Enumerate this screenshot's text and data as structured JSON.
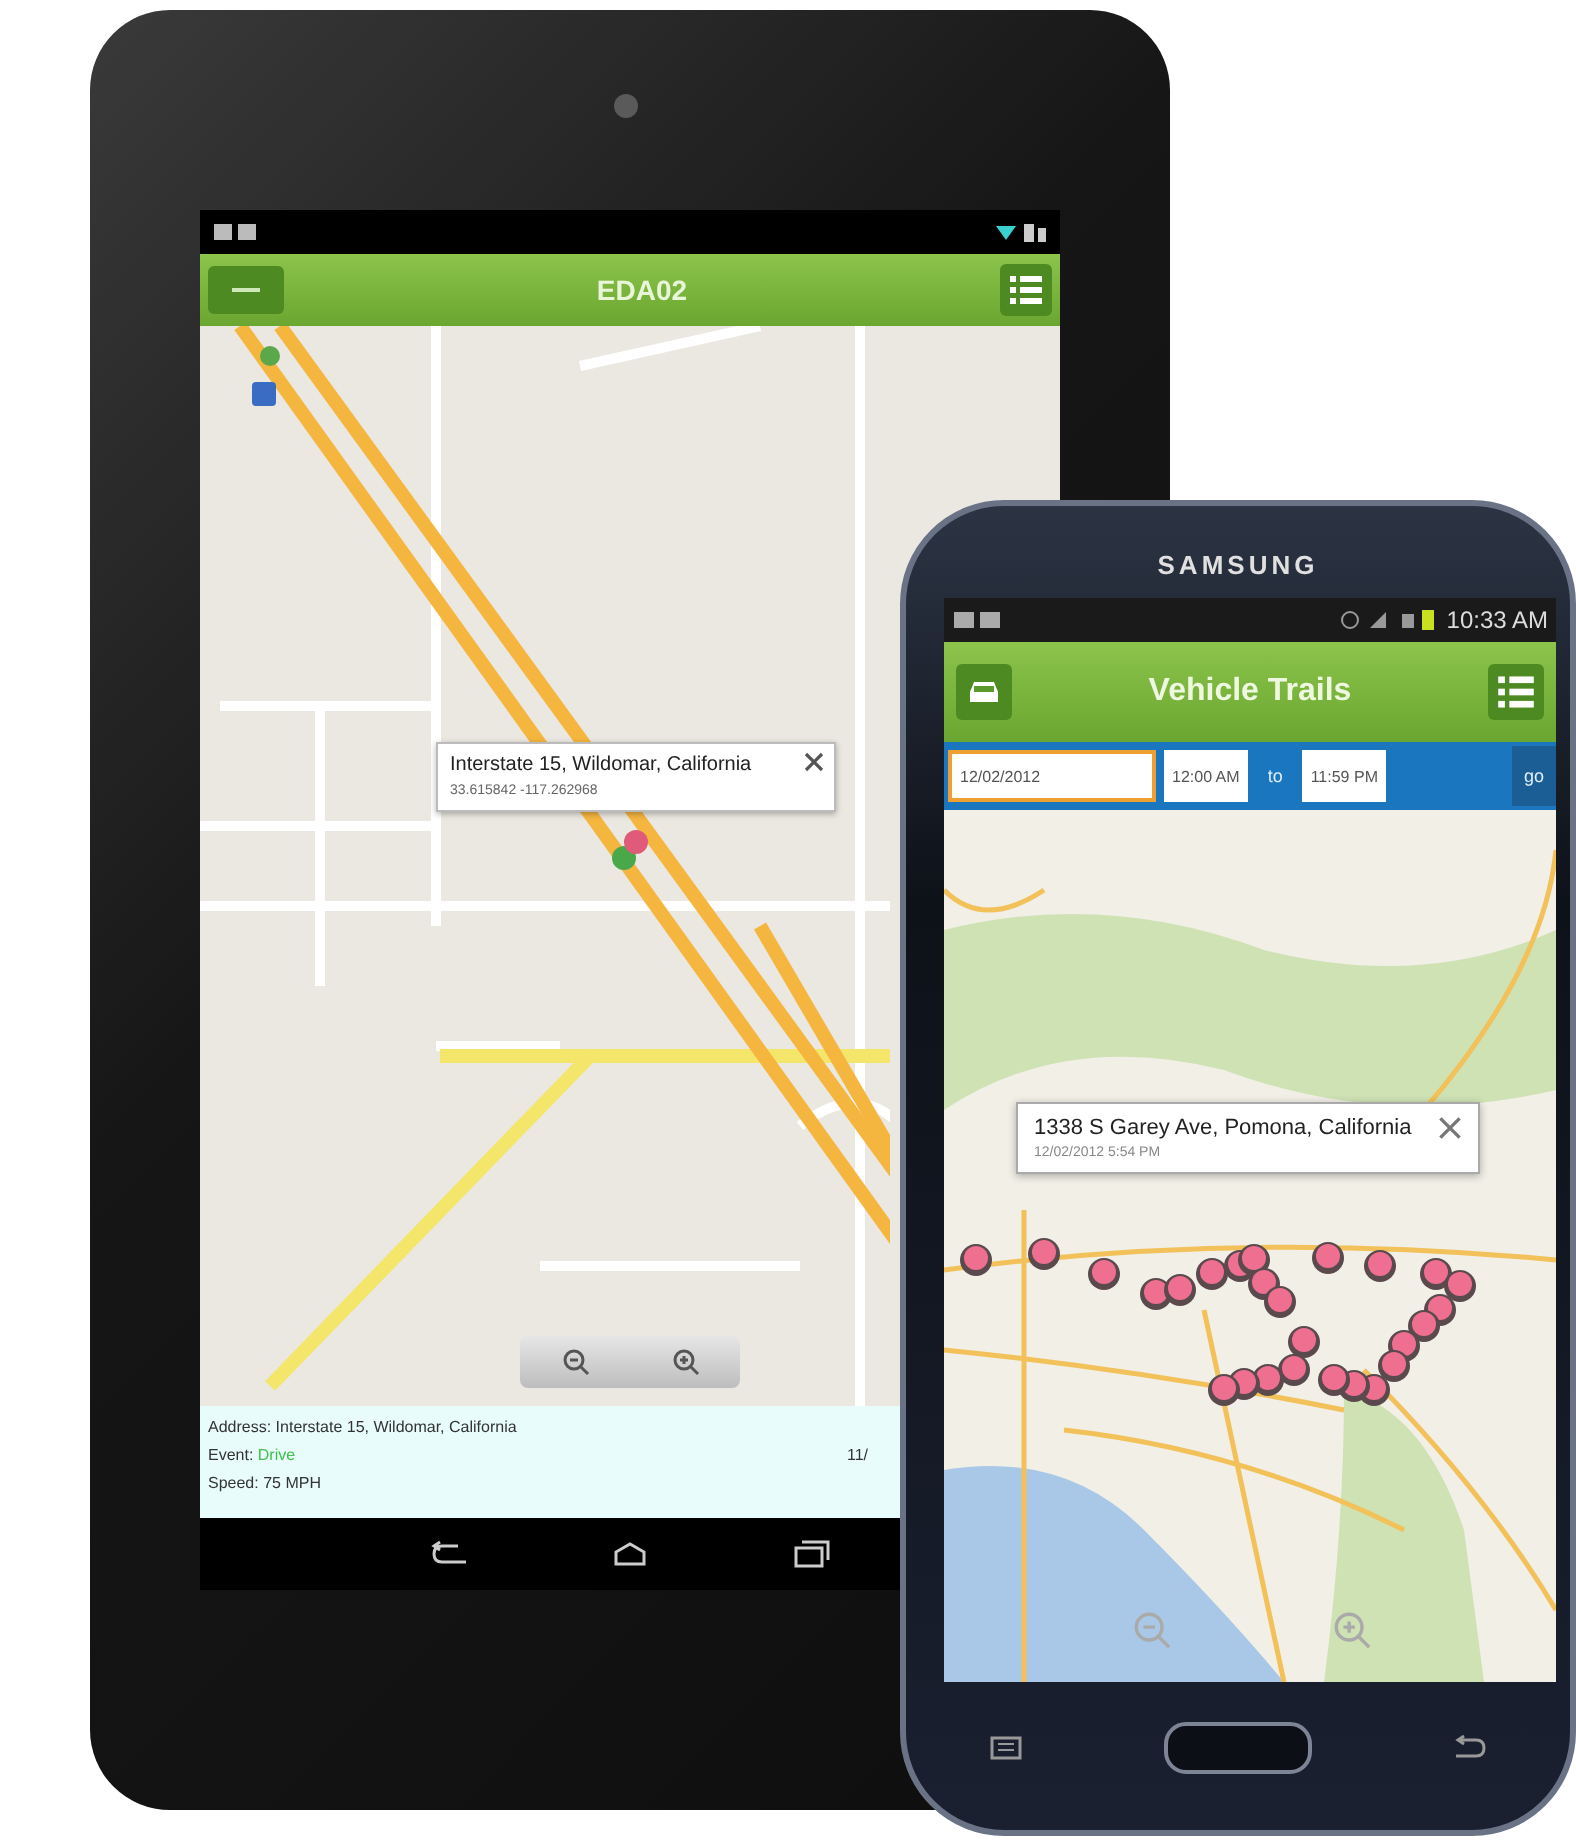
{
  "tablet": {
    "header": {
      "title": "EDA02"
    },
    "map": {
      "popup": {
        "title": "Interstate 15, Wildomar, California",
        "coordinates": "33.615842  -117.262968"
      }
    },
    "info_panel": {
      "address": "Address: Interstate 15, Wildomar, California",
      "event_label": "Event:",
      "event": "Drive",
      "speed": "Speed: 75 MPH",
      "date": "11/"
    }
  },
  "phone": {
    "brand": "SAMSUNG",
    "status_bar": {
      "time": "10:33 AM"
    },
    "header": {
      "title": "Vehicle Trails"
    },
    "filter": {
      "date": "12/02/2012",
      "from_time": "12:00 AM",
      "separator": "to",
      "to_time": "11:59 PM",
      "go_button": "go"
    },
    "map": {
      "popup": {
        "title": "1338 S Garey Ave, Pomona, California",
        "timestamp": "12/02/2012 5:54 PM"
      }
    }
  }
}
